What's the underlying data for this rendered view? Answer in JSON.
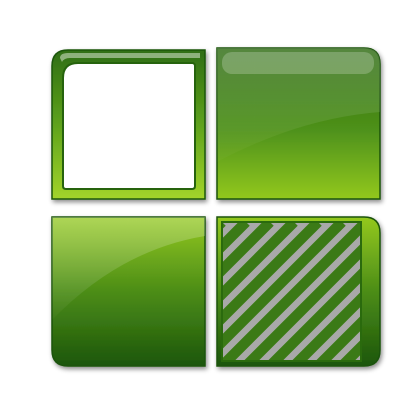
{
  "icon": {
    "name": "four-tile-grid-icon",
    "tiles": [
      {
        "position": "top-left",
        "style": "outline-frame"
      },
      {
        "position": "top-right",
        "style": "solid"
      },
      {
        "position": "bottom-left",
        "style": "solid"
      },
      {
        "position": "bottom-right",
        "style": "diagonal-stripes"
      }
    ],
    "colors": {
      "dark_green": "#1e5c0c",
      "mid_green": "#3f8416",
      "light_green": "#8cc418",
      "lime": "#a8d82a",
      "background": "#ffffff"
    }
  }
}
